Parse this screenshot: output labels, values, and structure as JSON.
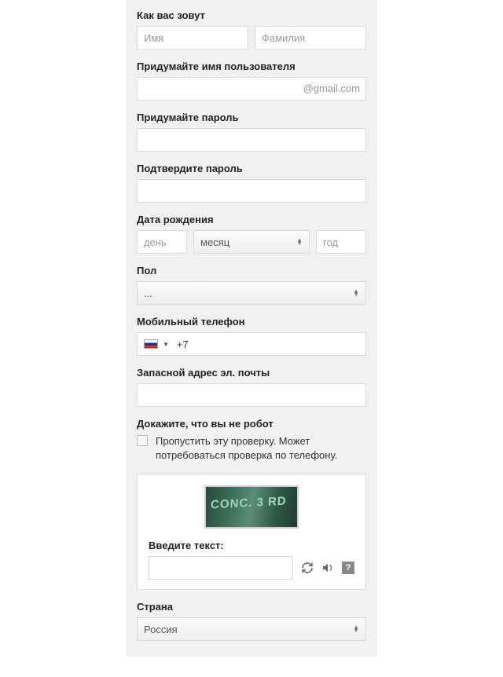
{
  "labels": {
    "name": "Как вас зовут",
    "firstname_ph": "Имя",
    "lastname_ph": "Фамилия",
    "username": "Придумайте имя пользователя",
    "username_suffix": "@gmail.com",
    "password": "Придумайте пароль",
    "confirm": "Подтвердите пароль",
    "dob": "Дата рождения",
    "day_ph": "день",
    "month_ph": "месяц",
    "year_ph": "год",
    "gender": "Пол",
    "gender_selected": "...",
    "phone": "Мобильный телефон",
    "phone_code": "+7",
    "recovery": "Запасной адрес эл. почты",
    "captcha_header": "Докажите, что вы не робот",
    "captcha_skip": "Пропустить эту проверку. Может потребоваться проверка по телефону.",
    "captcha_enter": "Введите текст:",
    "country": "Страна",
    "country_selected": "Россия"
  }
}
